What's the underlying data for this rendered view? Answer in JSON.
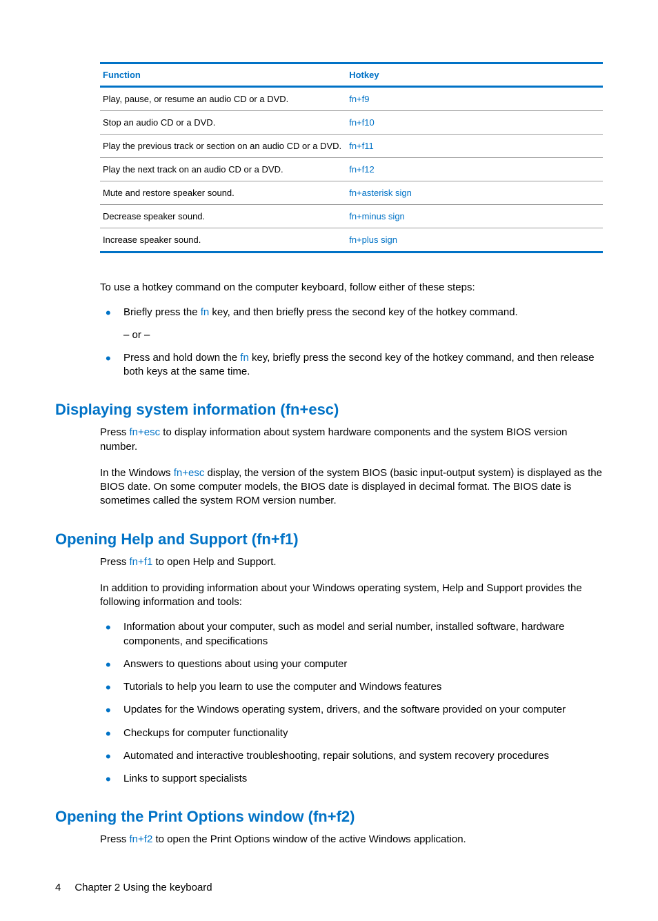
{
  "table": {
    "headers": {
      "func": "Function",
      "hotkey": "Hotkey"
    },
    "rows": [
      {
        "func": "Play, pause, or resume an audio CD or a DVD.",
        "hotkey": "fn+f9"
      },
      {
        "func": "Stop an audio CD or a DVD.",
        "hotkey": "fn+f10"
      },
      {
        "func": "Play the previous track or section on an audio CD or a DVD.",
        "hotkey": "fn+f11"
      },
      {
        "func": "Play the next track on an audio CD or a DVD.",
        "hotkey": "fn+f12"
      },
      {
        "func": "Mute and restore speaker sound.",
        "hotkey": "fn+asterisk sign"
      },
      {
        "func": "Decrease speaker sound.",
        "hotkey": "fn+minus sign"
      },
      {
        "func": "Increase speaker sound.",
        "hotkey": "fn+plus sign"
      }
    ]
  },
  "intro": {
    "lead": "To use a hotkey command on the computer keyboard, follow either of these steps:",
    "b1_pre": "Briefly press the ",
    "b1_key": "fn",
    "b1_post": " key, and then briefly press the second key of the hotkey command.",
    "or": "– or –",
    "b2_pre": "Press and hold down the ",
    "b2_key": "fn",
    "b2_post": " key, briefly press the second key of the hotkey command, and then release both keys at the same time."
  },
  "sec1": {
    "title": "Displaying system information (fn+esc)",
    "p1_pre": "Press ",
    "p1_key": "fn+esc",
    "p1_post": " to display information about system hardware components and the system BIOS version number.",
    "p2_pre": "In the Windows ",
    "p2_key": "fn+esc",
    "p2_post": " display, the version of the system BIOS (basic input-output system) is displayed as the BIOS date. On some computer models, the BIOS date is displayed in decimal format. The BIOS date is sometimes called the system ROM version number."
  },
  "sec2": {
    "title": "Opening Help and Support (fn+f1)",
    "p1_pre": "Press ",
    "p1_key": "fn+f1",
    "p1_post": " to open Help and Support.",
    "p2": "In addition to providing information about your Windows operating system, Help and Support provides the following information and tools:",
    "items": [
      "Information about your computer, such as model and serial number, installed software, hardware components, and specifications",
      "Answers to questions about using your computer",
      "Tutorials to help you learn to use the computer and Windows features",
      "Updates for the Windows operating system, drivers, and the software provided on your computer",
      "Checkups for computer functionality",
      "Automated and interactive troubleshooting, repair solutions, and system recovery procedures",
      "Links to support specialists"
    ]
  },
  "sec3": {
    "title": "Opening the Print Options window (fn+f2)",
    "p1_pre": "Press ",
    "p1_key": "fn+f2",
    "p1_post": " to open the Print Options window of the active Windows application."
  },
  "footer": {
    "page": "4",
    "chapter": "Chapter 2   Using the keyboard"
  }
}
